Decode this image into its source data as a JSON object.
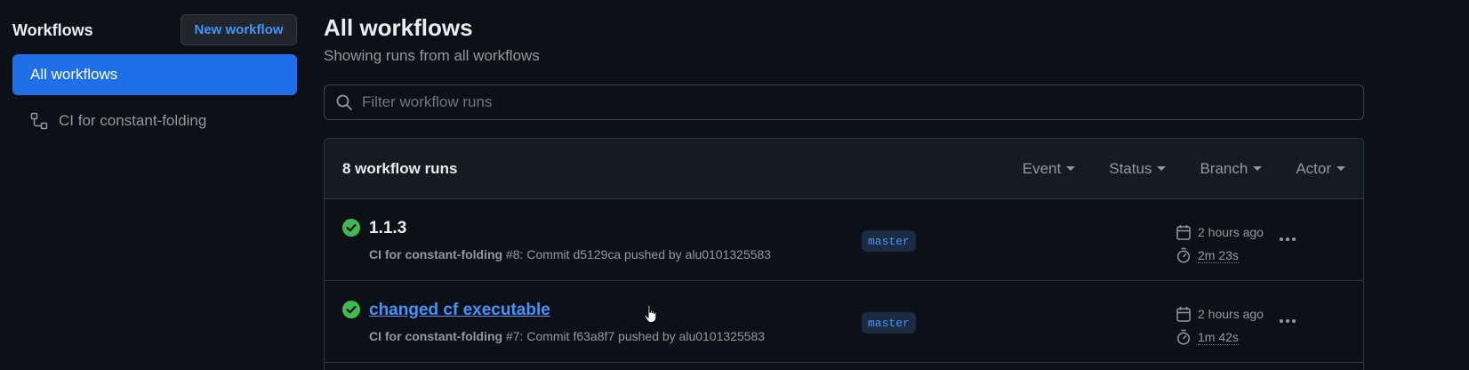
{
  "sidebar": {
    "title": "Workflows",
    "new_button": "New workflow",
    "items": [
      {
        "label": "All workflows"
      },
      {
        "label": "CI for constant-folding",
        "icon": "workflow-icon"
      }
    ]
  },
  "main": {
    "title": "All workflows",
    "subtitle": "Showing runs from all workflows",
    "filter_placeholder": "Filter workflow runs",
    "run_count": "8 workflow runs",
    "filters": [
      "Event",
      "Status",
      "Branch",
      "Actor"
    ],
    "runs": [
      {
        "title": "1.1.3",
        "workflow": "CI for constant-folding",
        "detail": "#8: Commit d5129ca pushed by alu0101325583",
        "branch": "master",
        "when": "2 hours ago",
        "duration": "2m 23s",
        "status": "success"
      },
      {
        "title": "changed cf executable",
        "workflow": "CI for constant-folding",
        "detail": "#7: Commit f63a8f7 pushed by alu0101325583",
        "branch": "master",
        "when": "2 hours ago",
        "duration": "1m 42s",
        "status": "success"
      }
    ]
  },
  "colors": {
    "background": "#0d1117",
    "accent": "#1f6feb",
    "link": "#4493f8",
    "success": "#3fb950"
  }
}
